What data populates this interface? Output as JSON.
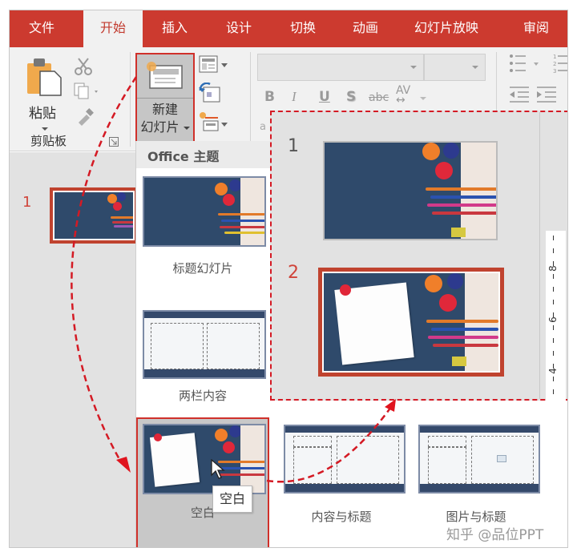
{
  "ribbon": {
    "tabs": [
      {
        "label": "文件",
        "active": false
      },
      {
        "label": "开始",
        "active": true
      },
      {
        "label": "插入",
        "active": false
      },
      {
        "label": "设计",
        "active": false
      },
      {
        "label": "切换",
        "active": false
      },
      {
        "label": "动画",
        "active": false
      },
      {
        "label": "幻灯片放映",
        "active": false
      },
      {
        "label": "审阅",
        "active": false
      }
    ],
    "clipboard": {
      "paste_label": "粘贴",
      "group_label": "剪贴板"
    },
    "slides": {
      "new_slide_label_line1": "新建",
      "new_slide_label_line2": "幻灯片"
    },
    "font": {
      "font_name": "",
      "font_size": "",
      "bold": "B",
      "italic": "I",
      "underline": "U",
      "shadow": "S",
      "strikethrough": "abc",
      "spacing": "AV"
    }
  },
  "thumbnail_pane": {
    "slide_number": "1"
  },
  "gallery": {
    "title": "Office 主题",
    "layouts": [
      {
        "label": "标题幻灯片"
      },
      {
        "label": "两栏内容"
      },
      {
        "label": "空白",
        "selected": true
      },
      {
        "label": "内容与标题"
      },
      {
        "label": "图片与标题"
      }
    ],
    "tooltip": "空白"
  },
  "preview": {
    "slides": [
      {
        "number": "1"
      },
      {
        "number": "2"
      }
    ],
    "ruler_labels": [
      "8",
      "6",
      "4"
    ]
  },
  "colors": {
    "accent": "#cc3a2f",
    "highlight_border": "#d0302a",
    "annotation": "#d41a24"
  },
  "watermark": "知乎 @品位PPT"
}
